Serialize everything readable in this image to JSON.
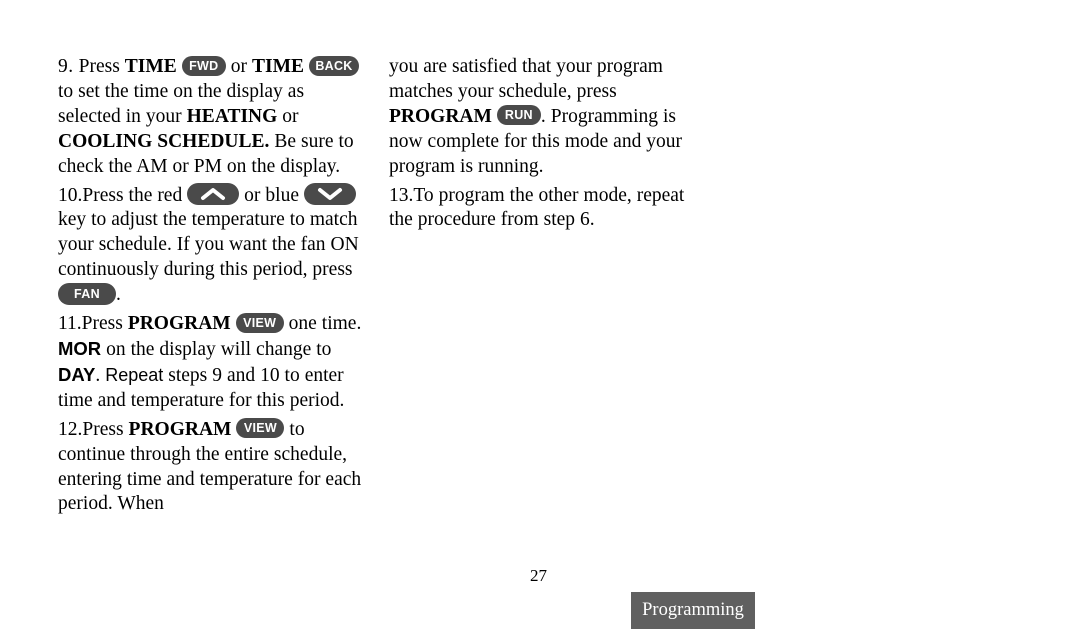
{
  "document": {
    "page_number": "27",
    "section_tab_label": "Programming",
    "tab_color": "#606060",
    "pill_color": "#4a4a4a"
  },
  "left_column": {
    "step9": {
      "number": "9.",
      "t1": "Press ",
      "b1": "TIME",
      "key_fwd": "FWD",
      "t2": " or ",
      "b2": "TIME",
      "key_back": "BACK",
      "t3": " to set the time on the display as selected in your ",
      "b3": "HEATING",
      "t4": " or ",
      "b4": "COOLING SCHEDULE.",
      "t5": " Be sure to check the AM or PM on the display."
    },
    "step10": {
      "number": "10.",
      "t1": "Press the red ",
      "key_up": "up-arrow",
      "t2": " or blue ",
      "key_down": "down-arrow",
      "t3": " key to adjust the temperature to match your schedule. If you want the fan ON continuously during this period, press ",
      "key_fan": "FAN",
      "t4": "."
    },
    "step11": {
      "number": "11.",
      "t1": "Press ",
      "b1": "PROGRAM",
      "key_view": "VIEW",
      "t2": " one time. ",
      "s1": "MOR",
      "t3": " on the display will change to ",
      "s2": "DAY",
      "t4": ". ",
      "s3": "Repeat",
      "t5": " steps 9 and 10 to enter time and temperature for this period."
    },
    "step12": {
      "number": "12.",
      "t1": "Press ",
      "b1": "PROGRAM",
      "key_view": "VIEW",
      "t2": " to continue through the entire schedule, entering time and temperature for each period. When"
    }
  },
  "right_column": {
    "step12_cont": {
      "t1": "you are satisfied that your program matches your schedule, press ",
      "b1": "PROGRAM",
      "key_run": "RUN",
      "t2": ". Programming is now complete for this mode and your program is running."
    },
    "step13": {
      "number": "13.",
      "t1": "To program the other mode, repeat the procedure from step 6."
    }
  }
}
